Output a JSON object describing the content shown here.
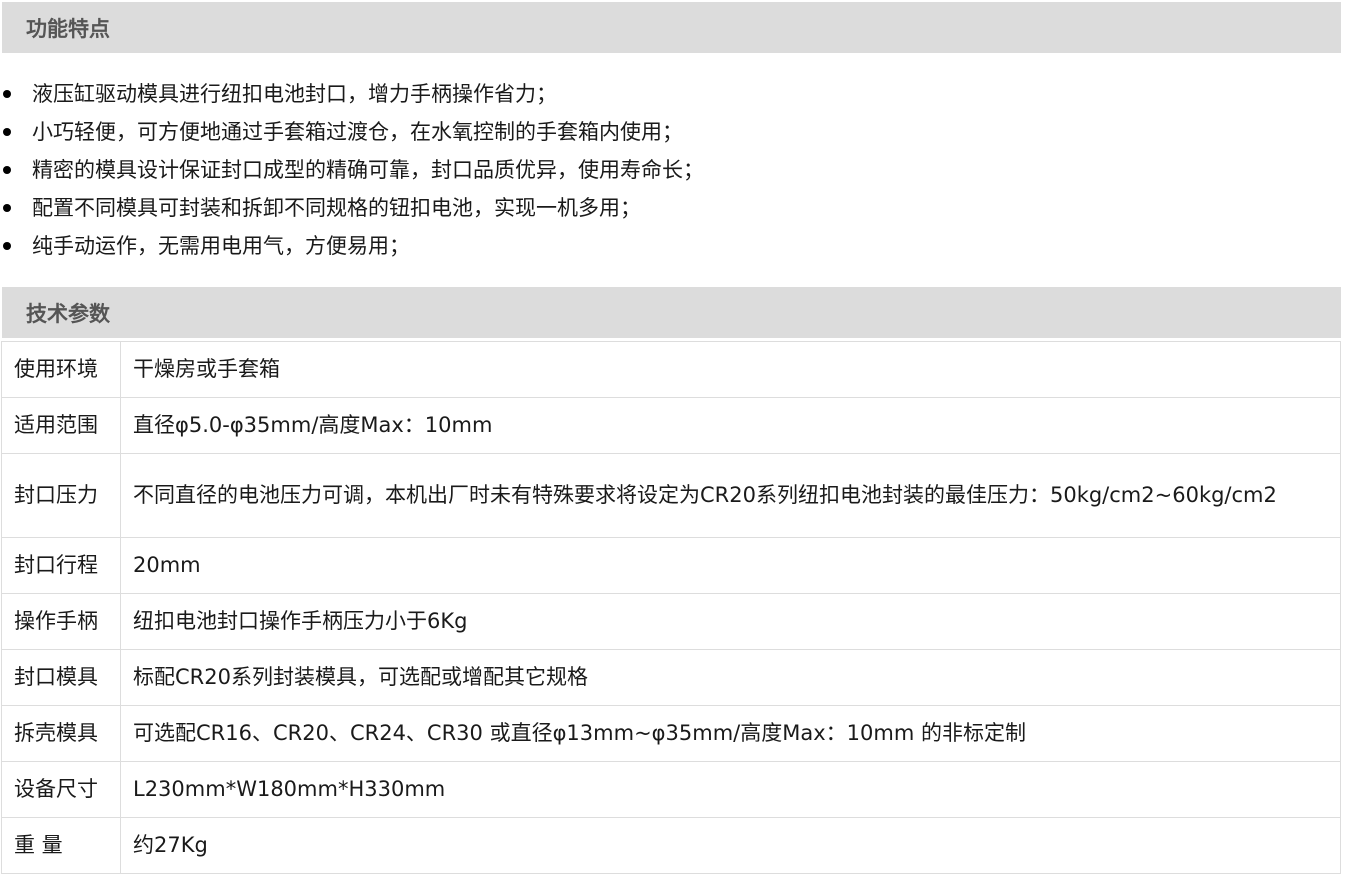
{
  "features": {
    "title": "功能特点",
    "items": [
      "液压缸驱动模具进行纽扣电池封口，增力手柄操作省力；",
      "小巧轻便，可方便地通过手套箱过渡仓，在水氧控制的手套箱内使用；",
      "精密的模具设计保证封口成型的精确可靠，封口品质优异，使用寿命长；",
      "配置不同模具可封装和拆卸不同规格的钮扣电池，实现一机多用；",
      "纯手动运作，无需用电用气，方便易用；"
    ]
  },
  "specs": {
    "title": "技术参数",
    "rows": [
      {
        "label": "使用环境",
        "value": "干燥房或手套箱"
      },
      {
        "label": "适用范围",
        "value": "直径φ5.0-φ35mm/高度Max：10mm"
      },
      {
        "label": "封口压力",
        "value": "不同直径的电池压力可调，本机出厂时未有特殊要求将设定为CR20系列纽扣电池封装的最佳压力：50kg/cm2~60kg/cm2"
      },
      {
        "label": "封口行程",
        "value": "20mm"
      },
      {
        "label": "操作手柄",
        "value": "纽扣电池封口操作手柄压力小于6Kg"
      },
      {
        "label": "封口模具",
        "value": "标配CR20系列封装模具，可选配或增配其它规格"
      },
      {
        "label": "拆壳模具",
        "value": "可选配CR16、CR20、CR24、CR30 或直径φ13mm~φ35mm/高度Max：10mm 的非标定制"
      },
      {
        "label": "设备尺寸",
        "value": "L230mm*W180mm*H330mm"
      },
      {
        "label": "重 量",
        "value": "约27Kg"
      }
    ]
  }
}
